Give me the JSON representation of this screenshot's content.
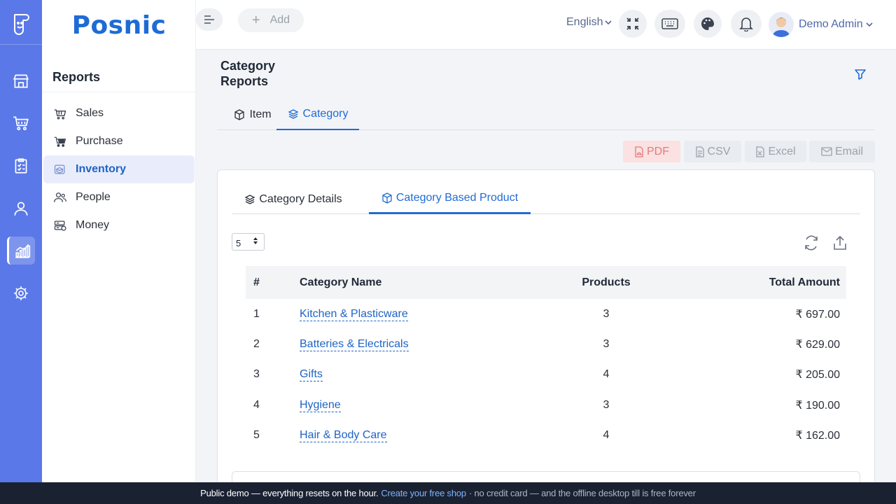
{
  "brand": "Posnic",
  "colors": {
    "rail": "#5a78e8",
    "accent": "#1e6bd6",
    "banner": "#1a2232"
  },
  "rail": {
    "items": [
      {
        "icon": "logo-icon"
      },
      {
        "icon": "store-icon"
      },
      {
        "icon": "cart-icon"
      },
      {
        "icon": "clipboard-icon"
      },
      {
        "icon": "user-icon"
      },
      {
        "icon": "chart-icon",
        "active": true
      },
      {
        "icon": "gear-icon"
      }
    ]
  },
  "sidebar": {
    "heading": "Reports",
    "items": [
      {
        "label": "Sales",
        "icon": "basket-icon"
      },
      {
        "label": "Purchase",
        "icon": "cart-icon"
      },
      {
        "label": "Inventory",
        "icon": "inventory-icon",
        "active": true
      },
      {
        "label": "People",
        "icon": "people-icon"
      },
      {
        "label": "Money",
        "icon": "money-icon"
      }
    ]
  },
  "header": {
    "add_label": "Add",
    "language": "English",
    "user_name": "Demo Admin"
  },
  "page": {
    "title": "Category Reports",
    "tabs": [
      {
        "label": "Item",
        "icon": "box-icon"
      },
      {
        "label": "Category",
        "icon": "layers-icon",
        "active": true
      }
    ],
    "export": {
      "pdf": "PDF",
      "csv": "CSV",
      "excel": "Excel",
      "email": "Email"
    }
  },
  "card": {
    "subtabs": [
      {
        "label": "Category Details",
        "icon": "layers-icon"
      },
      {
        "label": "Category Based Product",
        "icon": "box-icon",
        "active": true
      }
    ],
    "page_size": "5",
    "table": {
      "headers": [
        "#",
        "Category Name",
        "Products",
        "Total Amount"
      ],
      "rows": [
        {
          "num": "1",
          "name": "Kitchen & Plasticware",
          "products": "3",
          "amount": "₹ 697.00"
        },
        {
          "num": "2",
          "name": "Batteries & Electricals",
          "products": "3",
          "amount": "₹ 629.00"
        },
        {
          "num": "3",
          "name": "Gifts",
          "products": "4",
          "amount": "₹ 205.00"
        },
        {
          "num": "4",
          "name": "Hygiene",
          "products": "3",
          "amount": "₹ 190.00"
        },
        {
          "num": "5",
          "name": "Hair & Body Care",
          "products": "4",
          "amount": "₹ 162.00"
        }
      ]
    }
  },
  "banner": {
    "text": "Public demo — everything resets on the hour.",
    "link": "Create your free shop",
    "suffix": "· no credit card — and the offline desktop till is free forever"
  }
}
